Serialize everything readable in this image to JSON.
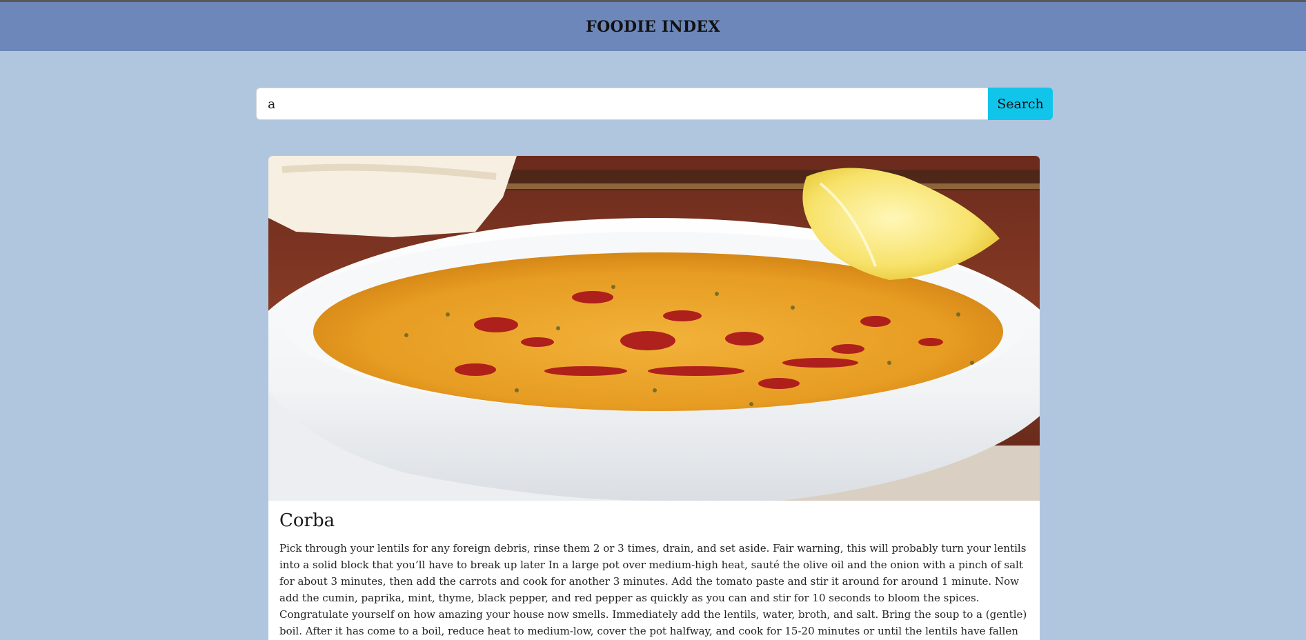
{
  "header": {
    "brand": "FOODIE INDEX"
  },
  "search": {
    "value": "a",
    "button_label": "Search"
  },
  "meal": {
    "title": "Corba",
    "instructions": "Pick through your lentils for any foreign debris, rinse them 2 or 3 times, drain, and set aside. Fair warning, this will probably turn your lentils into a solid block that you’ll have to break up later In a large pot over medium-high heat, sauté the olive oil and the onion with a pinch of salt for about 3 minutes, then add the carrots and cook for another 3 minutes. Add the tomato paste and stir it around for around 1 minute. Now add the cumin, paprika, mint, thyme, black pepper, and red pepper as quickly as you can and stir for 10 seconds to bloom the spices. Congratulate yourself on how amazing your house now smells. Immediately add the lentils, water, broth, and salt. Bring the soup to a (gentle) boil. After it has come to a boil, reduce heat to medium-low, cover the pot halfway, and cook for 15-20 minutes or until the lentils have fallen apart and the carrots are completely cooked. After the soup has cooked and the lentils"
  },
  "colors": {
    "page_background": "#b0c6df",
    "navbar": "#6d87ba",
    "search_button": "#11c5ea"
  }
}
